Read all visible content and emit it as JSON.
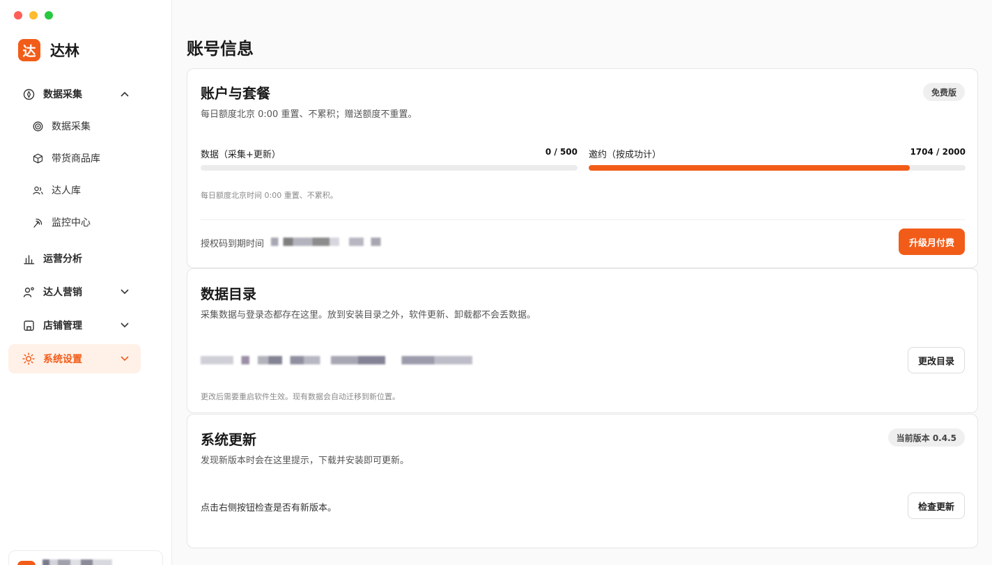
{
  "brand": {
    "logo_char": "达",
    "name": "达林"
  },
  "sidebar": {
    "items": [
      {
        "label": "数据采集",
        "icon": "compass-icon",
        "expanded": true
      },
      {
        "label": "数据采集",
        "icon": "target-icon"
      },
      {
        "label": "带货商品库",
        "icon": "box-icon"
      },
      {
        "label": "达人库",
        "icon": "users-icon"
      },
      {
        "label": "监控中心",
        "icon": "antenna-icon"
      },
      {
        "label": "运营分析",
        "icon": "bar-chart-icon"
      },
      {
        "label": "达人营销",
        "icon": "user-plus-icon"
      },
      {
        "label": "店铺管理",
        "icon": "store-icon"
      },
      {
        "label": "系统设置",
        "icon": "sun-gear-icon",
        "active": true
      }
    ]
  },
  "page": {
    "title": "账号信息"
  },
  "account": {
    "title": "账户与套餐",
    "badge": "免费版",
    "desc": "每日额度北京 0:00 重置、不累积；赠送额度不重置。",
    "quotas": [
      {
        "label": "数据（采集+更新）",
        "value": "0 / 500",
        "used": 0,
        "total": 500
      },
      {
        "label": "邀约（按成功计）",
        "value": "1704 / 2000",
        "used": 1704,
        "total": 2000
      }
    ],
    "note": "每日额度北京时间 0:00 重置、不累积。",
    "expiry_label": "授权码到期时间",
    "upgrade_label": "升级月付费"
  },
  "data_dir": {
    "title": "数据目录",
    "desc": "采集数据与登录态都存在这里。放到安装目录之外，软件更新、卸载都不会丢数据。",
    "change_label": "更改目录",
    "note": "更改后需要重启软件生效。现有数据会自动迁移到新位置。"
  },
  "update": {
    "title": "系统更新",
    "badge": "当前版本 0.4.5",
    "desc": "发现新版本时会在这里提示，下载并安装即可更新。",
    "hint": "点击右侧按钮检查是否有新版本。",
    "check_label": "检查更新"
  },
  "colors": {
    "accent": "#f25c19",
    "active_bg": "#fff1e8"
  }
}
